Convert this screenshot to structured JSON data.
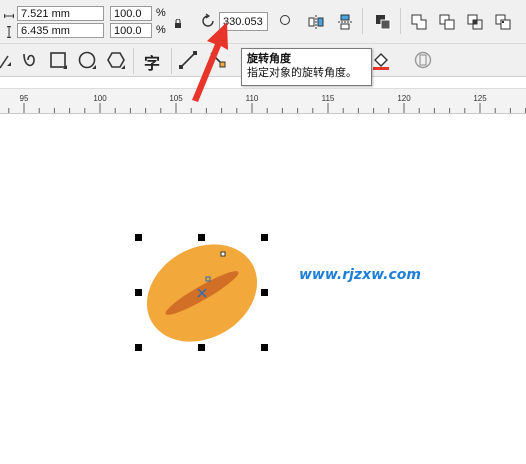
{
  "property_bar": {
    "width_value": "7.521 mm",
    "height_value": "6.435 mm",
    "scale_x": "100.0",
    "scale_y": "100.0",
    "percent_symbol": "%",
    "rotation_value": "330.053"
  },
  "tooltip": {
    "title": "旋转角度",
    "description": "指定对象的旋转角度。"
  },
  "text_tool_glyph": "字",
  "ruler": {
    "labels": [
      "95",
      "100",
      "105",
      "110",
      "115",
      "120",
      "125"
    ]
  },
  "watermark": "www.rjzxw.com",
  "colors": {
    "ellipse_fill": "#f2a83b",
    "inner_ellipse_fill": "#d26f27",
    "arrow": "#e8352a",
    "watermark": "#1f7fd6"
  }
}
